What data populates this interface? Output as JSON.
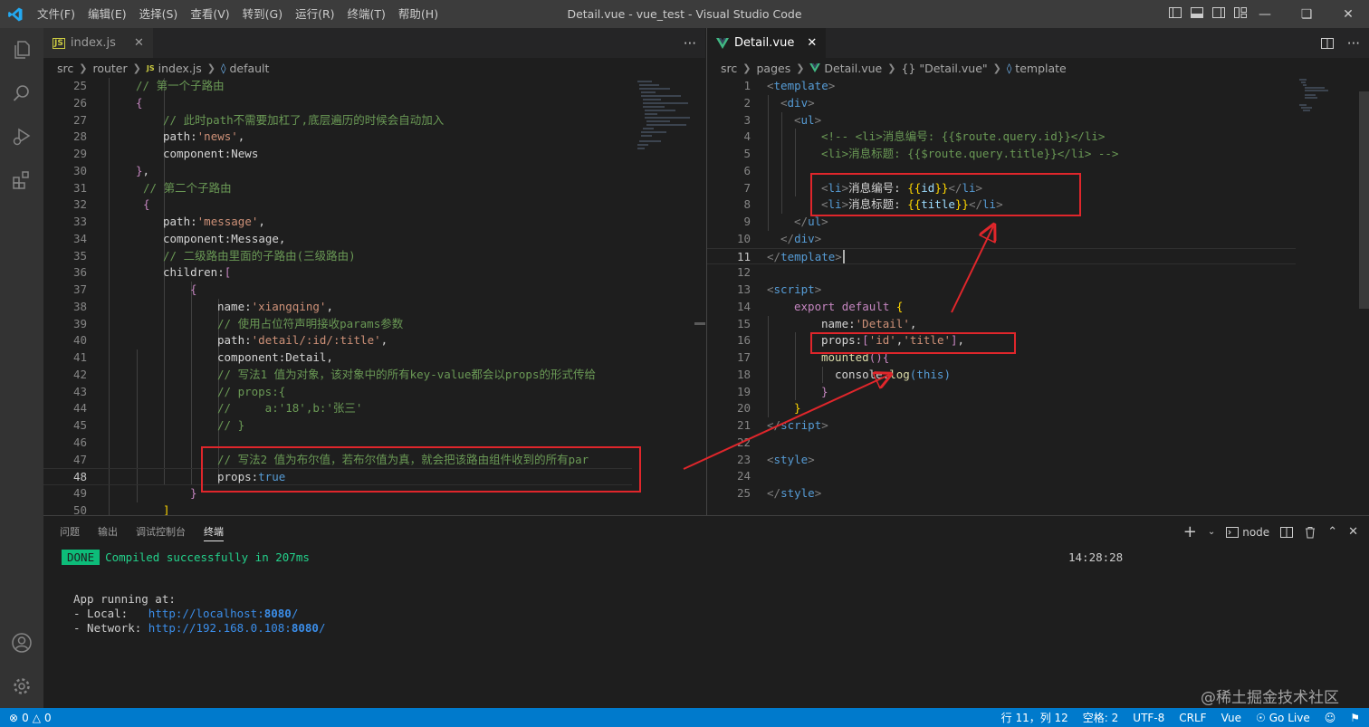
{
  "window": {
    "title": "Detail.vue - vue_test - Visual Studio Code"
  },
  "menu": [
    "文件(F)",
    "编辑(E)",
    "选择(S)",
    "查看(V)",
    "转到(G)",
    "运行(R)",
    "终端(T)",
    "帮助(H)"
  ],
  "left_editor": {
    "tab": {
      "name": "index.js",
      "badge": "JS"
    },
    "more": "···",
    "breadcrumb": [
      "src",
      "router",
      "index.js",
      "default"
    ],
    "lines": [
      "25",
      "26",
      "27",
      "28",
      "29",
      "30",
      "31",
      "32",
      "33",
      "34",
      "35",
      "36",
      "37",
      "38",
      "39",
      "40",
      "41",
      "42",
      "43",
      "44",
      "45",
      "46",
      "47",
      "48",
      "49",
      "50"
    ],
    "code": {
      "l25": "// 第一个子路由",
      "l27": "// 此时path不需要加杠了,底层遍历的时候会自动加入",
      "l28a": "path:",
      "l28b": "'news'",
      "l29": "component:News",
      "l31": "// 第二个子路由",
      "l33a": "path:",
      "l33b": "'message'",
      "l34": "component:Message,",
      "l35": "// 二级路由里面的子路由(三级路由)",
      "l36": "children:",
      "l38a": "name:",
      "l38b": "'xiangqing'",
      "l39": "// 使用占位符声明接收params参数",
      "l40a": "path:",
      "l40b": "'detail/:id/:title'",
      "l41": "component:Detail,",
      "l42": "// 写法1 值为对象，该对象中的所有key-value都会以props的形式传给",
      "l43": "// props:{",
      "l44": "//     a:'18',b:'张三'",
      "l45": "// }",
      "l47": "// 写法2 值为布尔值，若布尔值为真，就会把该路由组件收到的所有par",
      "l48a": "props:",
      "l48b": "true"
    }
  },
  "right_editor": {
    "tab": {
      "name": "Detail.vue"
    },
    "breadcrumb": [
      "src",
      "pages",
      "Detail.vue",
      "{} \"Detail.vue\"",
      "template"
    ],
    "lines": [
      "1",
      "2",
      "3",
      "4",
      "5",
      "6",
      "7",
      "8",
      "9",
      "10",
      "11",
      "12",
      "13",
      "14",
      "15",
      "16",
      "17",
      "18",
      "19",
      "20",
      "21",
      "22",
      "23",
      "24",
      "25"
    ],
    "code": {
      "template": "template",
      "div": "div",
      "ul": "ul",
      "l4": "<!-- <li>消息编号: {{$route.query.id}}</li>",
      "l5": "<li>消息标题: {{$route.query.title}}</li> -->",
      "li": "li",
      "l7text": "消息编号: ",
      "l7expr": "id",
      "l8text": "消息标题: ",
      "l8expr": "title",
      "script": "script",
      "export": "export",
      "default": "default",
      "l15a": "name:",
      "l15b": "'Detail'",
      "l16a": "props:",
      "l16b": "'id'",
      "l16c": "'title'",
      "mounted": "mounted",
      "console": "console",
      "log": "log",
      "this": "this",
      "style": "style"
    }
  },
  "panel": {
    "tabs": [
      "问题",
      "输出",
      "调试控制台",
      "终端"
    ],
    "active_tab": "终端",
    "shell": "node",
    "done_badge": "DONE",
    "compiled": "Compiled successfully in 207ms",
    "time": "14:28:28",
    "running": "App running at:",
    "local_label": "- Local:   ",
    "local_url": "http://localhost:",
    "local_port": "8080",
    "network_label": "- Network: ",
    "network_url": "http://192.168.0.108:",
    "network_port": "8080",
    "slash": "/"
  },
  "status": {
    "errors": "0",
    "warnings": "0",
    "position": "行 11，列 12",
    "spaces": "空格: 2",
    "encoding": "UTF-8",
    "eol": "CRLF",
    "language": "Vue",
    "golive": "Go Live"
  },
  "watermark": "@稀土掘金技术社区"
}
